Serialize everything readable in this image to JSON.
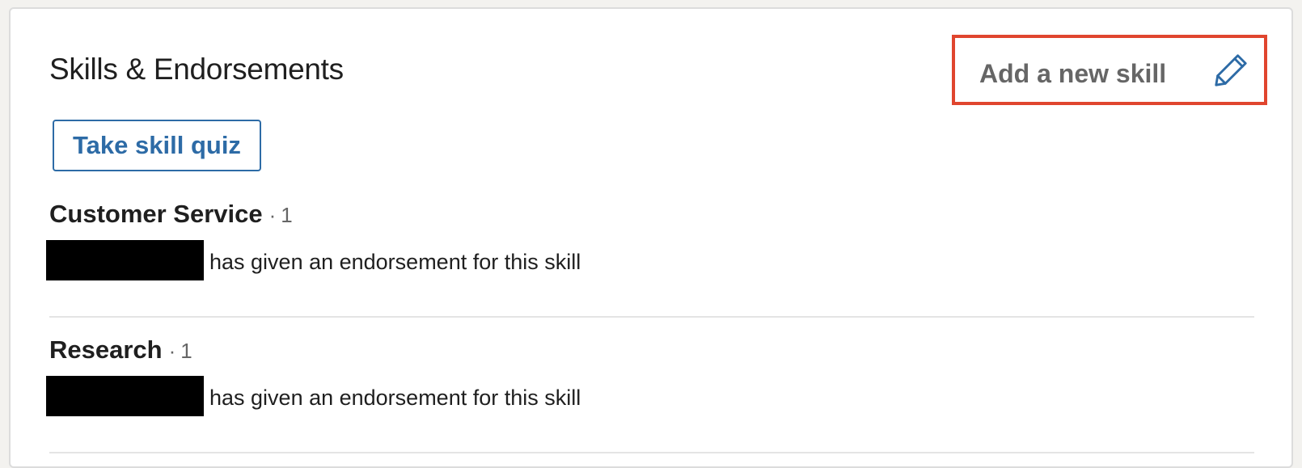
{
  "section": {
    "title": "Skills & Endorsements"
  },
  "add_skill": {
    "label": "Add a new skill",
    "icon": "pencil-icon",
    "highlight_color": "#e0452e"
  },
  "quiz_button": {
    "label": "Take skill quiz",
    "color": "#2d6ba6"
  },
  "skills": [
    {
      "name": "Customer Service",
      "separator": "·",
      "count": "1",
      "endorsement_text": "has given an endorsement for this skill"
    },
    {
      "name": "Research",
      "separator": "·",
      "count": "1",
      "endorsement_text": "has given an endorsement for this skill"
    }
  ]
}
